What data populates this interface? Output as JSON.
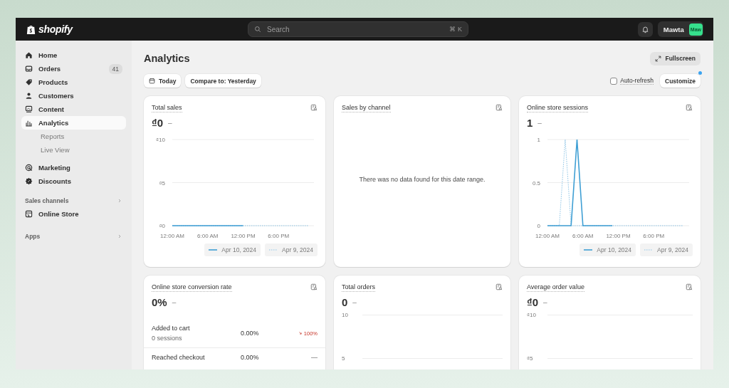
{
  "topbar": {
    "logo": "shopify",
    "search": {
      "placeholder": "Search",
      "shortcut": "⌘ K"
    },
    "user": {
      "name": "Mawta",
      "initials": "Maw"
    }
  },
  "sidebar": {
    "items": [
      {
        "label": "Home",
        "selected": false
      },
      {
        "label": "Orders",
        "badge": "41",
        "selected": false
      },
      {
        "label": "Products",
        "selected": false
      },
      {
        "label": "Customers",
        "selected": false
      },
      {
        "label": "Content",
        "selected": false
      },
      {
        "label": "Analytics",
        "selected": true,
        "children": [
          {
            "label": "Reports",
            "selected": false
          },
          {
            "label": "Live View",
            "selected": false
          }
        ]
      },
      {
        "label": "Marketing",
        "selected": false
      },
      {
        "label": "Discounts",
        "selected": false
      }
    ],
    "sections": [
      {
        "title": "Sales channels",
        "items": [
          {
            "label": "Online Store",
            "selected": false
          }
        ]
      },
      {
        "title": "Apps"
      }
    ]
  },
  "page": {
    "title": "Analytics",
    "fullscreen": "Fullscreen",
    "date": "Today",
    "compare": "Compare to: Yesterday",
    "auto_refresh": {
      "label": "Auto-refresh",
      "checked": false
    },
    "customize": {
      "label": "Customize",
      "notification": true
    }
  },
  "cards": [
    {
      "kind": "line",
      "title": "Total sales",
      "value": "₫0",
      "change": "–",
      "chart_data": {
        "type": "line",
        "xlim": [
          0,
          24
        ],
        "x": [
          0,
          1,
          2,
          3,
          4,
          5,
          6,
          7,
          8,
          9,
          10,
          11,
          12,
          13,
          14,
          15,
          16,
          17,
          18,
          19,
          20,
          21,
          22,
          23
        ],
        "xticks": [
          {
            "value": 0,
            "label": "12:00 AM"
          },
          {
            "value": 6,
            "label": "6:00 AM"
          },
          {
            "value": 12,
            "label": "12:00 PM"
          },
          {
            "value": 18,
            "label": "6:00 PM"
          }
        ],
        "yticks": [
          {
            "value": 0,
            "label": "₫0"
          },
          {
            "value": 5,
            "label": "₫5"
          },
          {
            "value": 10,
            "label": "₫10"
          }
        ],
        "ylim": [
          0,
          10
        ],
        "series": [
          {
            "name": "Apr 10, 2024",
            "color": "#3f9fd4",
            "line_style": "solid",
            "values": [
              0,
              0,
              0,
              0,
              0,
              0,
              0,
              0,
              0,
              0,
              0,
              0,
              0,
              null,
              null,
              null,
              null,
              null,
              null,
              null,
              null,
              null,
              null,
              null
            ]
          },
          {
            "name": "Apr 9, 2024",
            "color": "#8cc4e6",
            "line_style": "dotted",
            "values": [
              0,
              0,
              0,
              0,
              0,
              0,
              0,
              0,
              0,
              0,
              0,
              0,
              0,
              0,
              0,
              0,
              0,
              0,
              0,
              0,
              0,
              0,
              0,
              0
            ]
          }
        ]
      }
    },
    {
      "kind": "empty",
      "title": "Sales by channel",
      "message": "There was no data found for this date range."
    },
    {
      "kind": "line",
      "title": "Online store sessions",
      "value": "1",
      "change": "–",
      "chart_data": {
        "type": "line",
        "xlim": [
          0,
          24
        ],
        "x": [
          0,
          1,
          2,
          3,
          4,
          5,
          6,
          7,
          8,
          9,
          10,
          11,
          12,
          13,
          14,
          15,
          16,
          17,
          18,
          19,
          20,
          21,
          22,
          23
        ],
        "xticks": [
          {
            "value": 0,
            "label": "12:00 AM"
          },
          {
            "value": 6,
            "label": "6:00 AM"
          },
          {
            "value": 12,
            "label": "12:00 PM"
          },
          {
            "value": 18,
            "label": "6:00 PM"
          }
        ],
        "yticks": [
          {
            "value": 0,
            "label": "0"
          },
          {
            "value": 0.5,
            "label": "0.5"
          },
          {
            "value": 1,
            "label": "1"
          }
        ],
        "ylim": [
          0,
          1
        ],
        "series": [
          {
            "name": "Apr 10, 2024",
            "color": "#3f9fd4",
            "line_style": "solid",
            "values": [
              0,
              0,
              0,
              0,
              0,
              1,
              0,
              0,
              0,
              0,
              0,
              0,
              null,
              null,
              null,
              null,
              null,
              null,
              null,
              null,
              null,
              null,
              null,
              null
            ]
          },
          {
            "name": "Apr 9, 2024",
            "color": "#8cc4e6",
            "line_style": "dotted",
            "values": [
              0,
              0,
              0,
              1,
              0,
              0,
              0,
              0,
              0,
              0,
              0,
              0,
              0,
              0,
              0,
              0,
              0,
              0,
              0,
              0,
              0,
              0,
              0,
              0
            ]
          }
        ]
      }
    },
    {
      "kind": "funnel",
      "title": "Online store conversion rate",
      "value": "0%",
      "change": "–",
      "rows": [
        {
          "label": "Added to cart",
          "sub": "0 sessions",
          "rate": "0.00%",
          "change": "100%",
          "kind": "down"
        },
        {
          "label": "Reached checkout",
          "rate": "0.00%",
          "change": "—",
          "kind": "flat"
        }
      ]
    },
    {
      "kind": "axis",
      "title": "Total orders",
      "value": "0",
      "change": "–",
      "y_labels": [
        "10",
        "5"
      ]
    },
    {
      "kind": "axis",
      "title": "Average order value",
      "value": "₫0",
      "change": "–",
      "y_labels": [
        "₫10",
        "₫5"
      ]
    }
  ]
}
